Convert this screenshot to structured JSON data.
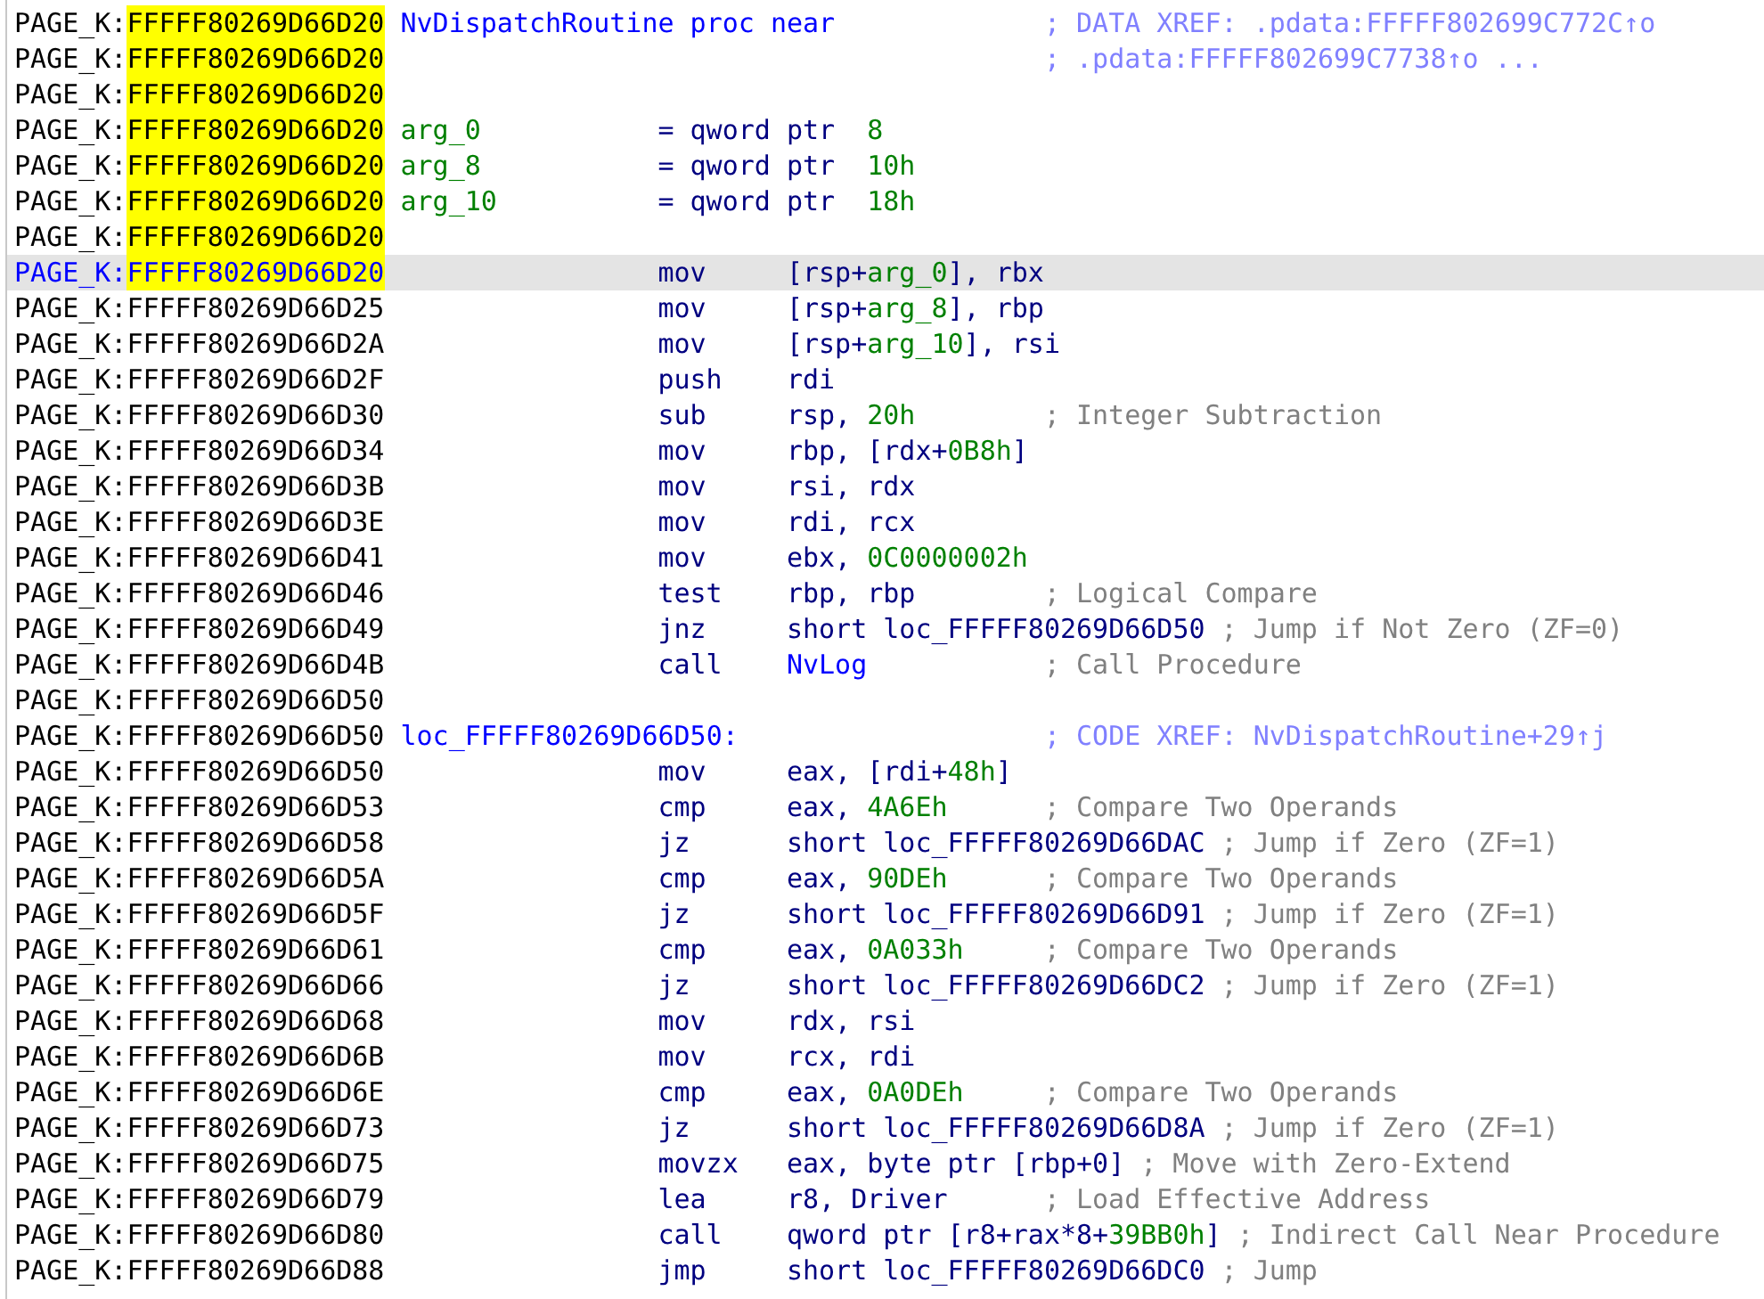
{
  "listing": [
    {
      "kind": "label",
      "segment": "PAGE_K:",
      "address": "FFFFF80269D66D20",
      "highlighted": true,
      "selected": false,
      "label": {
        "kind": "name",
        "text": "NvDispatchRoutine proc near"
      },
      "comment": {
        "kind": "xref",
        "text": "; DATA XREF: .pdata:FFFFF802699C772C↑o"
      }
    },
    {
      "kind": "label",
      "segment": "PAGE_K:",
      "address": "FFFFF80269D66D20",
      "highlighted": true,
      "selected": false,
      "comment": {
        "kind": "xref",
        "text": "; .pdata:FFFFF802699C7738↑o ..."
      }
    },
    {
      "kind": "blank",
      "segment": "PAGE_K:",
      "address": "FFFFF80269D66D20",
      "highlighted": true,
      "selected": false
    },
    {
      "kind": "decl",
      "segment": "PAGE_K:",
      "address": "FFFFF80269D66D20",
      "highlighted": true,
      "selected": false,
      "label": {
        "kind": "var",
        "text": "arg_0"
      },
      "mnemonic": "=",
      "operands": [
        {
          "kind": "plain",
          "text": "qword ptr  "
        },
        {
          "kind": "num",
          "text": "8"
        }
      ]
    },
    {
      "kind": "decl",
      "segment": "PAGE_K:",
      "address": "FFFFF80269D66D20",
      "highlighted": true,
      "selected": false,
      "label": {
        "kind": "var",
        "text": "arg_8"
      },
      "mnemonic": "=",
      "operands": [
        {
          "kind": "plain",
          "text": "qword ptr  "
        },
        {
          "kind": "num",
          "text": "10h"
        }
      ]
    },
    {
      "kind": "decl",
      "segment": "PAGE_K:",
      "address": "FFFFF80269D66D20",
      "highlighted": true,
      "selected": false,
      "label": {
        "kind": "var",
        "text": "arg_10"
      },
      "mnemonic": "=",
      "operands": [
        {
          "kind": "plain",
          "text": "qword ptr  "
        },
        {
          "kind": "num",
          "text": "18h"
        }
      ]
    },
    {
      "kind": "blank",
      "segment": "PAGE_K:",
      "address": "FFFFF80269D66D20",
      "highlighted": true,
      "selected": false
    },
    {
      "kind": "code",
      "segment": "PAGE_K:",
      "address": "FFFFF80269D66D20",
      "highlighted": true,
      "selected": true,
      "mnemonic": "mov",
      "operands": [
        {
          "kind": "plain",
          "text": "[rsp+"
        },
        {
          "kind": "num",
          "text": "arg_0"
        },
        {
          "kind": "plain",
          "text": "], rbx"
        }
      ]
    },
    {
      "kind": "code",
      "segment": "PAGE_K:",
      "address": "FFFFF80269D66D25",
      "highlighted": false,
      "selected": false,
      "mnemonic": "mov",
      "operands": [
        {
          "kind": "plain",
          "text": "[rsp+"
        },
        {
          "kind": "num",
          "text": "arg_8"
        },
        {
          "kind": "plain",
          "text": "], rbp"
        }
      ]
    },
    {
      "kind": "code",
      "segment": "PAGE_K:",
      "address": "FFFFF80269D66D2A",
      "highlighted": false,
      "selected": false,
      "mnemonic": "mov",
      "operands": [
        {
          "kind": "plain",
          "text": "[rsp+"
        },
        {
          "kind": "num",
          "text": "arg_10"
        },
        {
          "kind": "plain",
          "text": "], rsi"
        }
      ]
    },
    {
      "kind": "code",
      "segment": "PAGE_K:",
      "address": "FFFFF80269D66D2F",
      "highlighted": false,
      "selected": false,
      "mnemonic": "push",
      "operands": [
        {
          "kind": "plain",
          "text": "rdi"
        }
      ]
    },
    {
      "kind": "code",
      "segment": "PAGE_K:",
      "address": "FFFFF80269D66D30",
      "highlighted": false,
      "selected": false,
      "mnemonic": "sub",
      "operands": [
        {
          "kind": "plain",
          "text": "rsp, "
        },
        {
          "kind": "num",
          "text": "20h"
        }
      ],
      "comment": {
        "kind": "note",
        "text": "; Integer Subtraction"
      }
    },
    {
      "kind": "code",
      "segment": "PAGE_K:",
      "address": "FFFFF80269D66D34",
      "highlighted": false,
      "selected": false,
      "mnemonic": "mov",
      "operands": [
        {
          "kind": "plain",
          "text": "rbp, [rdx+"
        },
        {
          "kind": "num",
          "text": "0B8h"
        },
        {
          "kind": "plain",
          "text": "]"
        }
      ]
    },
    {
      "kind": "code",
      "segment": "PAGE_K:",
      "address": "FFFFF80269D66D3B",
      "highlighted": false,
      "selected": false,
      "mnemonic": "mov",
      "operands": [
        {
          "kind": "plain",
          "text": "rsi, rdx"
        }
      ]
    },
    {
      "kind": "code",
      "segment": "PAGE_K:",
      "address": "FFFFF80269D66D3E",
      "highlighted": false,
      "selected": false,
      "mnemonic": "mov",
      "operands": [
        {
          "kind": "plain",
          "text": "rdi, rcx"
        }
      ]
    },
    {
      "kind": "code",
      "segment": "PAGE_K:",
      "address": "FFFFF80269D66D41",
      "highlighted": false,
      "selected": false,
      "mnemonic": "mov",
      "operands": [
        {
          "kind": "plain",
          "text": "ebx, "
        },
        {
          "kind": "num",
          "text": "0C0000002h"
        }
      ]
    },
    {
      "kind": "code",
      "segment": "PAGE_K:",
      "address": "FFFFF80269D66D46",
      "highlighted": false,
      "selected": false,
      "mnemonic": "test",
      "operands": [
        {
          "kind": "plain",
          "text": "rbp, rbp"
        }
      ],
      "comment": {
        "kind": "note",
        "text": "; Logical Compare"
      }
    },
    {
      "kind": "code",
      "segment": "PAGE_K:",
      "address": "FFFFF80269D66D49",
      "highlighted": false,
      "selected": false,
      "mnemonic": "jnz",
      "operands": [
        {
          "kind": "plain",
          "text": "short loc_FFFFF80269D66D50"
        }
      ],
      "comment": {
        "kind": "note",
        "text": "; Jump if Not Zero (ZF=0)"
      }
    },
    {
      "kind": "code",
      "segment": "PAGE_K:",
      "address": "FFFFF80269D66D4B",
      "highlighted": false,
      "selected": false,
      "mnemonic": "call",
      "operands": [
        {
          "kind": "name",
          "text": "NvLog"
        }
      ],
      "comment": {
        "kind": "note",
        "text": "; Call Procedure"
      }
    },
    {
      "kind": "blank",
      "segment": "PAGE_K:",
      "address": "FFFFF80269D66D50",
      "highlighted": false,
      "selected": false
    },
    {
      "kind": "label",
      "segment": "PAGE_K:",
      "address": "FFFFF80269D66D50",
      "highlighted": false,
      "selected": false,
      "label": {
        "kind": "name",
        "text": "loc_FFFFF80269D66D50:"
      },
      "comment": {
        "kind": "xref",
        "text": "; CODE XREF: NvDispatchRoutine+29↑j"
      }
    },
    {
      "kind": "code",
      "segment": "PAGE_K:",
      "address": "FFFFF80269D66D50",
      "highlighted": false,
      "selected": false,
      "mnemonic": "mov",
      "operands": [
        {
          "kind": "plain",
          "text": "eax, [rdi+"
        },
        {
          "kind": "num",
          "text": "48h"
        },
        {
          "kind": "plain",
          "text": "]"
        }
      ]
    },
    {
      "kind": "code",
      "segment": "PAGE_K:",
      "address": "FFFFF80269D66D53",
      "highlighted": false,
      "selected": false,
      "mnemonic": "cmp",
      "operands": [
        {
          "kind": "plain",
          "text": "eax, "
        },
        {
          "kind": "num",
          "text": "4A6Eh"
        }
      ],
      "comment": {
        "kind": "note",
        "text": "; Compare Two Operands"
      }
    },
    {
      "kind": "code",
      "segment": "PAGE_K:",
      "address": "FFFFF80269D66D58",
      "highlighted": false,
      "selected": false,
      "mnemonic": "jz",
      "operands": [
        {
          "kind": "plain",
          "text": "short loc_FFFFF80269D66DAC"
        }
      ],
      "comment": {
        "kind": "note",
        "text": "; Jump if Zero (ZF=1)"
      }
    },
    {
      "kind": "code",
      "segment": "PAGE_K:",
      "address": "FFFFF80269D66D5A",
      "highlighted": false,
      "selected": false,
      "mnemonic": "cmp",
      "operands": [
        {
          "kind": "plain",
          "text": "eax, "
        },
        {
          "kind": "num",
          "text": "90DEh"
        }
      ],
      "comment": {
        "kind": "note",
        "text": "; Compare Two Operands"
      }
    },
    {
      "kind": "code",
      "segment": "PAGE_K:",
      "address": "FFFFF80269D66D5F",
      "highlighted": false,
      "selected": false,
      "mnemonic": "jz",
      "operands": [
        {
          "kind": "plain",
          "text": "short loc_FFFFF80269D66D91"
        }
      ],
      "comment": {
        "kind": "note",
        "text": "; Jump if Zero (ZF=1)"
      }
    },
    {
      "kind": "code",
      "segment": "PAGE_K:",
      "address": "FFFFF80269D66D61",
      "highlighted": false,
      "selected": false,
      "mnemonic": "cmp",
      "operands": [
        {
          "kind": "plain",
          "text": "eax, "
        },
        {
          "kind": "num",
          "text": "0A033h"
        }
      ],
      "comment": {
        "kind": "note",
        "text": "; Compare Two Operands"
      }
    },
    {
      "kind": "code",
      "segment": "PAGE_K:",
      "address": "FFFFF80269D66D66",
      "highlighted": false,
      "selected": false,
      "mnemonic": "jz",
      "operands": [
        {
          "kind": "plain",
          "text": "short loc_FFFFF80269D66DC2"
        }
      ],
      "comment": {
        "kind": "note",
        "text": "; Jump if Zero (ZF=1)"
      }
    },
    {
      "kind": "code",
      "segment": "PAGE_K:",
      "address": "FFFFF80269D66D68",
      "highlighted": false,
      "selected": false,
      "mnemonic": "mov",
      "operands": [
        {
          "kind": "plain",
          "text": "rdx, rsi"
        }
      ]
    },
    {
      "kind": "code",
      "segment": "PAGE_K:",
      "address": "FFFFF80269D66D6B",
      "highlighted": false,
      "selected": false,
      "mnemonic": "mov",
      "operands": [
        {
          "kind": "plain",
          "text": "rcx, rdi"
        }
      ]
    },
    {
      "kind": "code",
      "segment": "PAGE_K:",
      "address": "FFFFF80269D66D6E",
      "highlighted": false,
      "selected": false,
      "mnemonic": "cmp",
      "operands": [
        {
          "kind": "plain",
          "text": "eax, "
        },
        {
          "kind": "num",
          "text": "0A0DEh"
        }
      ],
      "comment": {
        "kind": "note",
        "text": "; Compare Two Operands"
      }
    },
    {
      "kind": "code",
      "segment": "PAGE_K:",
      "address": "FFFFF80269D66D73",
      "highlighted": false,
      "selected": false,
      "mnemonic": "jz",
      "operands": [
        {
          "kind": "plain",
          "text": "short loc_FFFFF80269D66D8A"
        }
      ],
      "comment": {
        "kind": "note",
        "text": "; Jump if Zero (ZF=1)"
      }
    },
    {
      "kind": "code",
      "segment": "PAGE_K:",
      "address": "FFFFF80269D66D75",
      "highlighted": false,
      "selected": false,
      "mnemonic": "movzx",
      "operands": [
        {
          "kind": "plain",
          "text": "eax, byte ptr [rbp+0]"
        }
      ],
      "comment": {
        "kind": "note",
        "text": "; Move with Zero-Extend"
      }
    },
    {
      "kind": "code",
      "segment": "PAGE_K:",
      "address": "FFFFF80269D66D79",
      "highlighted": false,
      "selected": false,
      "mnemonic": "lea",
      "operands": [
        {
          "kind": "plain",
          "text": "r8, Driver"
        }
      ],
      "comment": {
        "kind": "note",
        "text": "; Load Effective Address"
      }
    },
    {
      "kind": "code",
      "segment": "PAGE_K:",
      "address": "FFFFF80269D66D80",
      "highlighted": false,
      "selected": false,
      "mnemonic": "call",
      "operands": [
        {
          "kind": "plain",
          "text": "qword ptr [r8+rax*8+"
        },
        {
          "kind": "num",
          "text": "39BB0h"
        },
        {
          "kind": "plain",
          "text": "]"
        }
      ],
      "comment": {
        "kind": "note",
        "text": "; Indirect Call Near Procedure"
      }
    },
    {
      "kind": "code",
      "segment": "PAGE_K:",
      "address": "FFFFF80269D66D88",
      "highlighted": false,
      "selected": false,
      "mnemonic": "jmp",
      "operands": [
        {
          "kind": "plain",
          "text": "short loc_FFFFF80269D66DC0"
        }
      ],
      "comment": {
        "kind": "note",
        "text": "; Jump"
      }
    }
  ]
}
